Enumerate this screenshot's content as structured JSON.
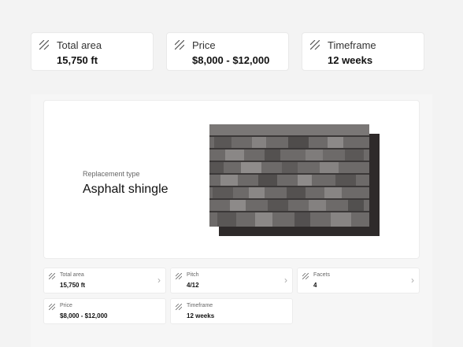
{
  "summary": {
    "total_area": {
      "label": "Total area",
      "value": "15,750 ft",
      "icon": "hatch-icon"
    },
    "price": {
      "label": "Price",
      "value": "$8,000 - $12,000",
      "icon": "hatch-icon"
    },
    "timeframe": {
      "label": "Timeframe",
      "value": "12 weeks",
      "icon": "hatch-icon"
    }
  },
  "feature": {
    "label": "Replacement type",
    "value": "Asphalt shingle"
  },
  "details": {
    "total_area": {
      "label": "Total area",
      "value": "15,750 ft"
    },
    "pitch": {
      "label": "Pitch",
      "value": "4/12"
    },
    "facets": {
      "label": "Facets",
      "value": "4"
    },
    "price": {
      "label": "Price",
      "value": "$8,000 - $12,000"
    },
    "timeframe": {
      "label": "Timeframe",
      "value": "12 weeks"
    },
    "chevron": "›"
  }
}
